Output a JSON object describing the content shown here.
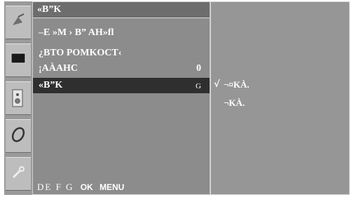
{
  "menu": {
    "title": "«B”K",
    "items": [
      {
        "label": "–E   »M › B”  AH»fl",
        "value": ""
      },
      {
        "label": "¿BTO   POMKOCT‹",
        "value": ""
      },
      {
        "label": "¡AÀAHC",
        "value": "0"
      },
      {
        "label": "«B”K",
        "value": "G"
      }
    ],
    "footer": {
      "symbols": "DE  F  G",
      "ok": "OK",
      "menu": "MENU"
    }
  },
  "submenu": {
    "options": [
      {
        "label": "¬¤KÀ.",
        "checked": true,
        "check_mark": "√"
      },
      {
        "label": "¬KÀ.",
        "checked": false,
        "check_mark": ""
      }
    ]
  },
  "sidebar": {
    "icons": [
      "satellite-dish-icon",
      "monitor-icon",
      "speaker-icon",
      "clock-icon",
      "wrench-icon"
    ]
  }
}
